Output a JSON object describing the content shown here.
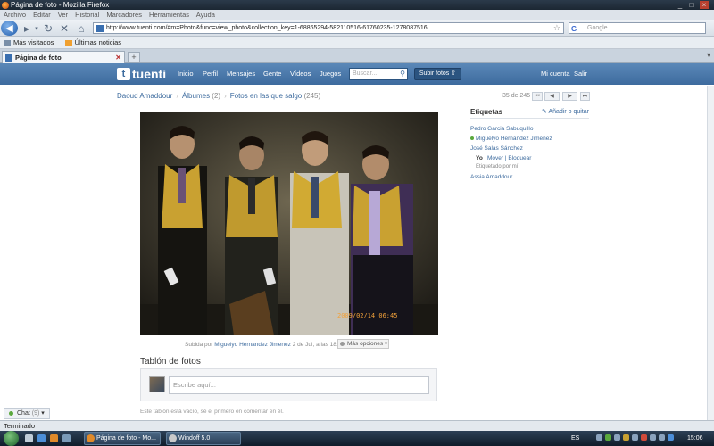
{
  "window": {
    "title": "Página de foto - Mozilla Firefox",
    "buttons": [
      "_",
      "□",
      "×"
    ]
  },
  "menu": [
    "Archivo",
    "Editar",
    "Ver",
    "Historial",
    "Marcadores",
    "Herramientas",
    "Ayuda"
  ],
  "navbar": {
    "url": "http://www.tuenti.com/#m=Photo&func=view_photo&collection_key=1-68865294-582110516-61760235-1278087516",
    "search_placeholder": "Google"
  },
  "bookmarks": [
    {
      "label": "Más visitados",
      "icon": "bookmarks-folder-icon"
    },
    {
      "label": "Últimas noticias",
      "icon": "rss-feed-icon"
    }
  ],
  "tabs": [
    {
      "label": "Página de foto"
    }
  ],
  "tuenti": {
    "logo": "tuenti",
    "nav": [
      "Inicio",
      "Perfil",
      "Mensajes",
      "Gente",
      "Vídeos",
      "Juegos"
    ],
    "search_placeholder": "Buscar...",
    "upload_label": "Subir fotos",
    "right_nav": [
      "Mi cuenta",
      "Salir"
    ]
  },
  "breadcrumb": {
    "user": "Daoud Amaddour",
    "albums": "Álbumes",
    "albums_count": "(2)",
    "album": "Fotos en las que salgo",
    "album_count": "(245)"
  },
  "pager": {
    "text": "35 de 245"
  },
  "photo": {
    "date_stamp": "2009/02/14 06:45",
    "uploaded_prefix": "Subida por",
    "uploader": "Miguelyo Hernandez Jimenez",
    "uploaded_suffix": "2 de Jul, a las 18:04",
    "more_options": "Más opciones"
  },
  "wall": {
    "title": "Tablón de fotos",
    "placeholder": "Escribe aquí...",
    "empty": "Este tablón está vacío, sé el primero en comentar en él."
  },
  "tags": {
    "title": "Etiquetas",
    "add_label": "Añadir o quitar",
    "people": [
      {
        "name": "Pedro Garcia Sabuquillo",
        "online": false
      },
      {
        "name": "Miguelyo Hernandez Jimenez",
        "online": true
      },
      {
        "name": "José Salas Sánchez",
        "online": false
      },
      {
        "name": "Assia Amaddour",
        "online": false
      }
    ],
    "you_label": "Yo",
    "you_actions": "Mover | Bloquear",
    "tagged_by": "Etiquetado por mí"
  },
  "chat": {
    "label": "Chat",
    "count": "(9)"
  },
  "status": {
    "text": "Terminado"
  },
  "taskbar": {
    "tasks": [
      "Página de foto - Mo...",
      "Windoff 5.0"
    ],
    "lang": "ES",
    "clock": "15:06"
  }
}
